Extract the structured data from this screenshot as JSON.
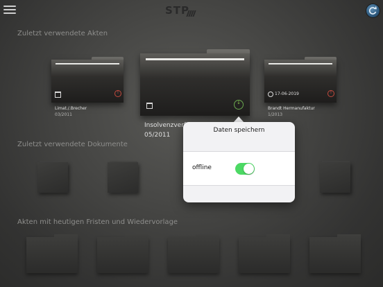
{
  "header": {
    "logo_text": "STP",
    "menu_icon": "hamburger-menu-icon",
    "refresh_icon": "refresh-icon"
  },
  "sections": {
    "recent_files": "Zuletzt verwendete Akten",
    "recent_documents": "Zuletzt verwendete Dokumente",
    "deadlines": "Akten mit heutigen Fristen und Wiedervorlage"
  },
  "recent_files": [
    {
      "title": "Limat./.Brecher",
      "subtitle": "03/2011",
      "status": "alert"
    },
    {
      "title": "Insolvenzverf",
      "subtitle": "05/2011",
      "status": "offline-saved"
    },
    {
      "title": "Brandt Hermanufaktur",
      "subtitle": "1/2013",
      "date": "17-06-2019",
      "status": "alert"
    }
  ],
  "popover": {
    "title": "Daten speichern",
    "option_label": "offline",
    "option_enabled": true
  },
  "colors": {
    "toggle_on": "#4cd964",
    "alert_badge": "#c44a3c",
    "saved_badge": "#6aa84f"
  }
}
